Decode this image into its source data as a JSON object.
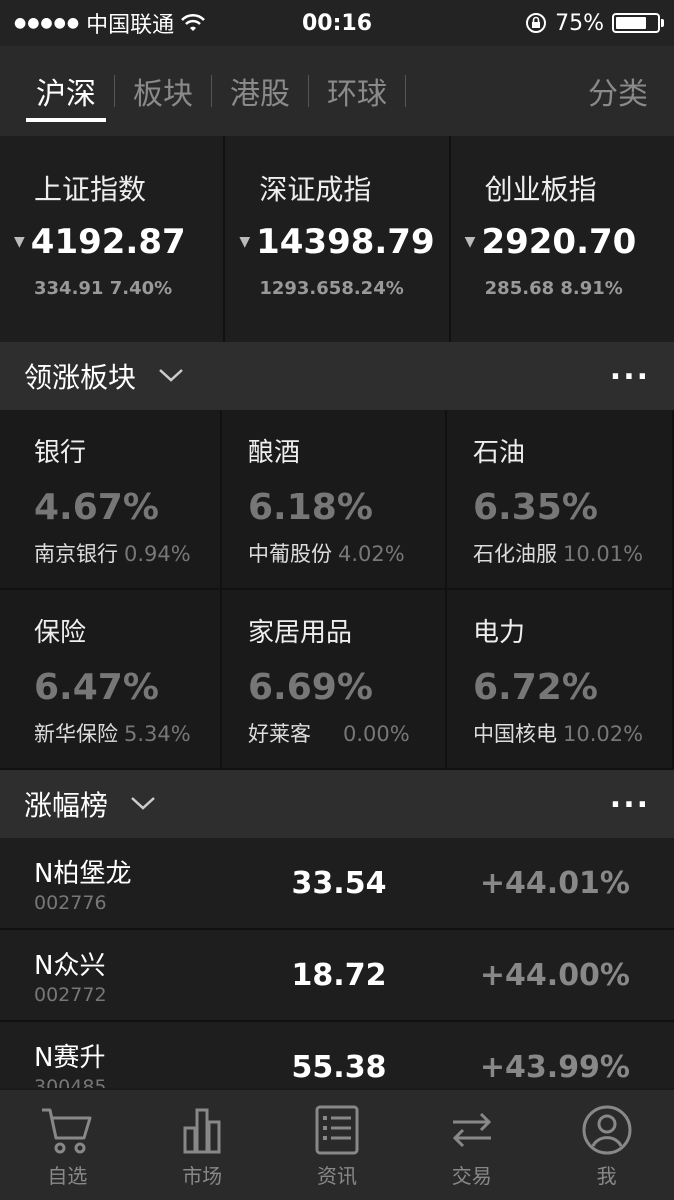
{
  "status_bar": {
    "signal": "●●●●●",
    "carrier": "中国联通",
    "time": "00:16",
    "battery": "75%",
    "battery_level": 0.75
  },
  "top_nav": {
    "tabs": [
      "沪深",
      "板块",
      "港股",
      "环球"
    ],
    "active_tab": 0,
    "right_label": "分类"
  },
  "indices": [
    {
      "name": "上证指数",
      "value": "4192.87",
      "change": "334.91 7.40%"
    },
    {
      "name": "深证成指",
      "value": "14398.79",
      "change": "1293.658.24%"
    },
    {
      "name": "创业板指",
      "value": "2920.70",
      "change": "285.68 8.91%"
    }
  ],
  "sector_section": {
    "title": "领涨板块",
    "more": "...",
    "sectors": [
      {
        "name": "银行",
        "pct": "4.67%",
        "leader": "南京银行",
        "leader_pct": "0.94%"
      },
      {
        "name": "酿酒",
        "pct": "6.18%",
        "leader": "中葡股份",
        "leader_pct": "4.02%"
      },
      {
        "name": "石油",
        "pct": "6.35%",
        "leader": "石化油服",
        "leader_pct": "10.01%"
      },
      {
        "name": "保险",
        "pct": "6.47%",
        "leader": "新华保险",
        "leader_pct": "5.34%"
      },
      {
        "name": "家居用品",
        "pct": "6.69%",
        "leader": "好莱客",
        "leader_pct": "0.00%"
      },
      {
        "name": "电力",
        "pct": "6.72%",
        "leader": "中国核电",
        "leader_pct": "10.02%"
      }
    ]
  },
  "gain_section": {
    "title": "涨幅榜",
    "more": "...",
    "rows": [
      {
        "name": "N柏堡龙",
        "code": "002776",
        "price": "33.54",
        "pct": "+44.01%"
      },
      {
        "name": "N众兴",
        "code": "002772",
        "price": "18.72",
        "pct": "+44.00%"
      },
      {
        "name": "N赛升",
        "code": "300485",
        "price": "55.38",
        "pct": "+43.99%"
      }
    ]
  },
  "tab_bar": {
    "items": [
      {
        "label": "自选",
        "icon": "cart-icon"
      },
      {
        "label": "市场",
        "icon": "bar-chart-icon"
      },
      {
        "label": "资讯",
        "icon": "news-icon"
      },
      {
        "label": "交易",
        "icon": "exchange-icon"
      },
      {
        "label": "我",
        "icon": "profile-icon"
      }
    ]
  }
}
